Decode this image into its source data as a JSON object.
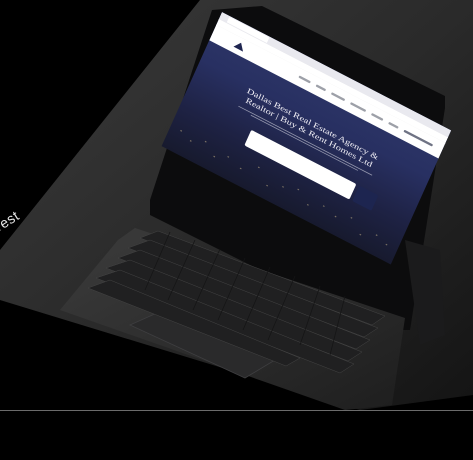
{
  "caption": {
    "text": "vest"
  },
  "site": {
    "hero_title": "Dallas Best Real Estate Agency & Realtor | Buy & Rent Homes Ltd"
  },
  "colors": {
    "background": "#000000",
    "screen_navy": "#2b3466",
    "divider": "#6b6b6b"
  }
}
